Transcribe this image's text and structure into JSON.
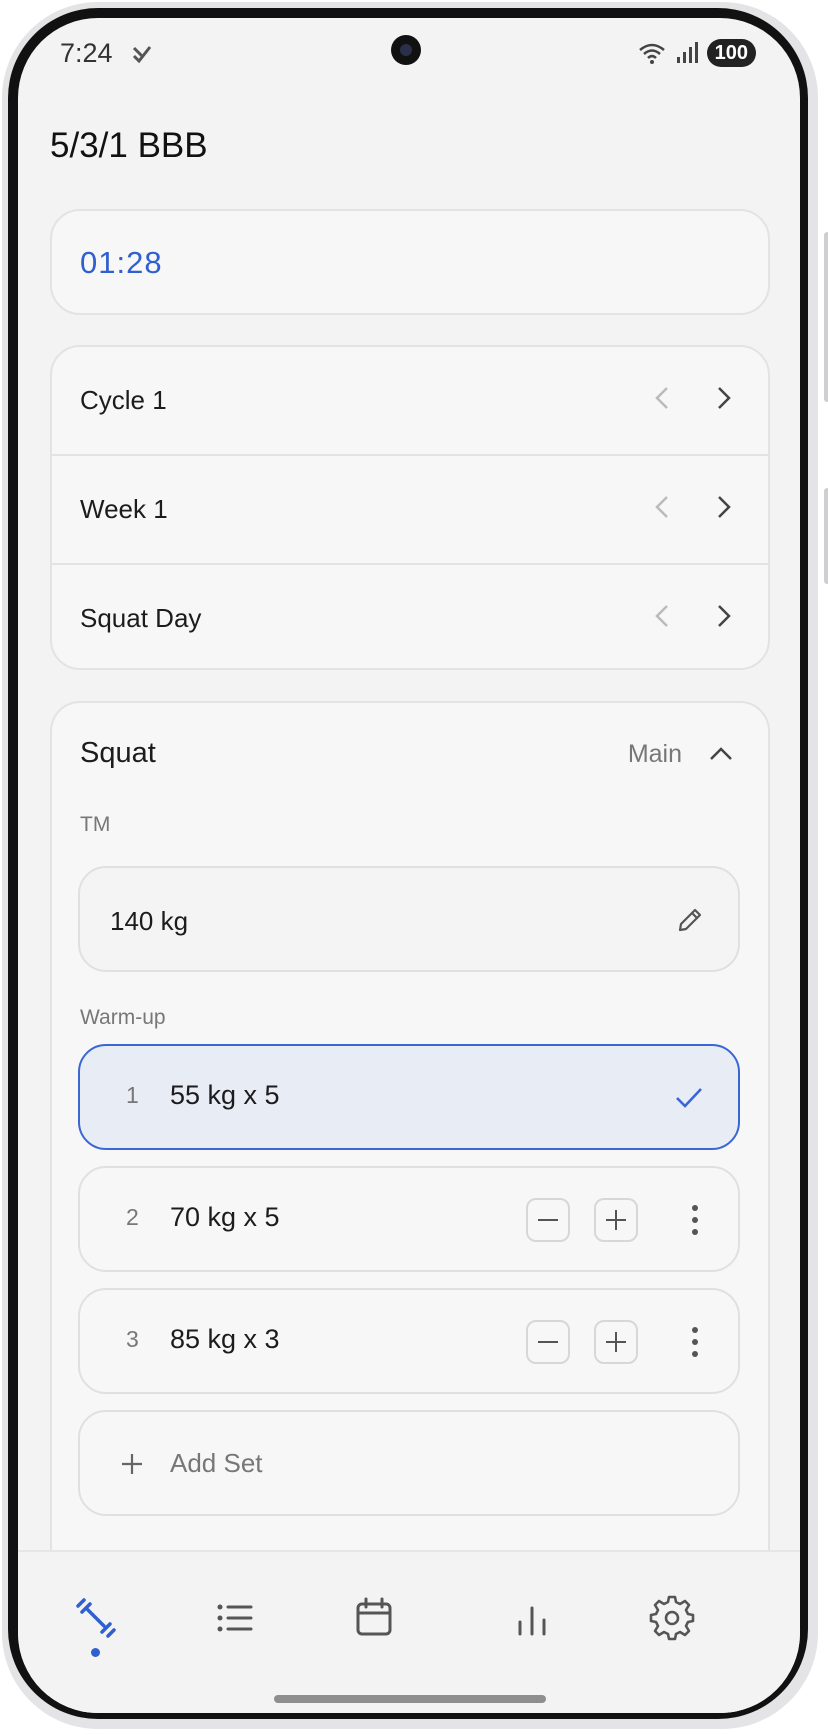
{
  "status_bar": {
    "time": "7:24",
    "battery": "100"
  },
  "app": {
    "title": "5/3/1 BBB"
  },
  "timer": {
    "value": "01:28"
  },
  "program_nav": [
    {
      "label": "Cycle 1"
    },
    {
      "label": "Week 1"
    },
    {
      "label": "Squat Day"
    }
  ],
  "exercise": {
    "name": "Squat",
    "type": "Main",
    "tm_label": "TM",
    "tm_value": "140 kg",
    "warmup_label": "Warm-up",
    "sets": [
      {
        "number": "1",
        "text": "55 kg x 5",
        "completed": true
      },
      {
        "number": "2",
        "text": "70 kg x 5",
        "completed": false
      },
      {
        "number": "3",
        "text": "85 kg x 3",
        "completed": false
      }
    ],
    "add_set_label": "Add Set"
  },
  "bottom_nav": {
    "items": [
      {
        "icon": "dumbbell-icon",
        "active": true
      },
      {
        "icon": "list-icon",
        "active": false
      },
      {
        "icon": "calendar-icon",
        "active": false
      },
      {
        "icon": "bar-chart-icon",
        "active": false
      },
      {
        "icon": "gear-icon",
        "active": false
      }
    ]
  },
  "colors": {
    "accent": "#2f5fd0",
    "background": "#f3f3f3",
    "card": "#f7f7f7"
  }
}
